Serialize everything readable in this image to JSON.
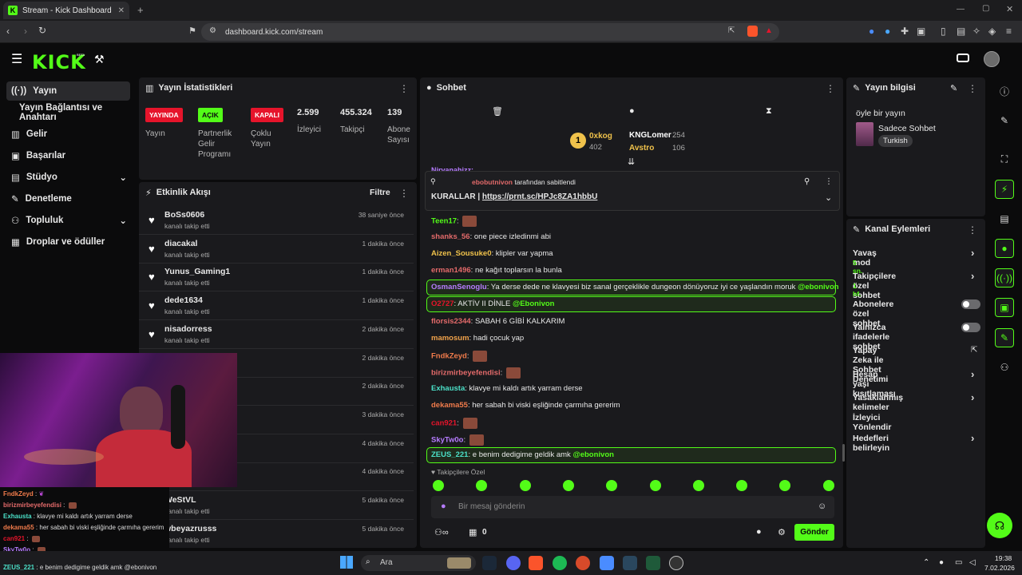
{
  "browser": {
    "tab_title": "Stream - Kick Dashboard",
    "url": "dashboard.kick.com/stream",
    "new_tab": "+"
  },
  "nav": {
    "logo": "KICK",
    "beta": "BETA"
  },
  "sidebar": {
    "items": [
      {
        "label": "Yayın",
        "icon": "broadcast-icon"
      },
      {
        "label": "Yayın Bağlantısı ve Anahtarı",
        "icon": ""
      },
      {
        "label": "Gelir",
        "icon": "chart-icon"
      },
      {
        "label": "Başarılar",
        "icon": "trophy-icon"
      },
      {
        "label": "Stüdyo",
        "icon": "studio-icon"
      },
      {
        "label": "Denetleme",
        "icon": "wrench-icon"
      },
      {
        "label": "Topluluk",
        "icon": "people-icon"
      },
      {
        "label": "Droplar ve ödüller",
        "icon": "gift-icon"
      }
    ]
  },
  "stats": {
    "title": "Yayın İstatistikleri",
    "badges": [
      {
        "text": "YAYINDA",
        "label": "Yayın",
        "color": "#e6142b"
      },
      {
        "text": "AÇIK",
        "label": "Partnerlik\nGelir\nProgramı",
        "color": "#53fc18"
      },
      {
        "text": "KAPALI",
        "label": "Çoklu\nYayın",
        "color": "#e6142b"
      }
    ],
    "numbers": [
      {
        "value": "2.599",
        "label": "İzleyici"
      },
      {
        "value": "455.324",
        "label": "Takipçi"
      },
      {
        "value": "139",
        "label": "Abone\nSayısı"
      }
    ]
  },
  "activity": {
    "title": "Etkinlik Akışı",
    "filter": "Filtre",
    "items": [
      {
        "name": "BoSs0606",
        "sub": "kanalı takip etti",
        "time": "38 saniye önce"
      },
      {
        "name": "diacakal",
        "sub": "kanalı takip etti",
        "time": "1 dakika önce"
      },
      {
        "name": "Yunus_Gaming1",
        "sub": "kanalı takip etti",
        "time": "1 dakika önce"
      },
      {
        "name": "dede1634",
        "sub": "kanalı takip etti",
        "time": "1 dakika önce"
      },
      {
        "name": "nisadorress",
        "sub": "kanalı takip etti",
        "time": "2 dakika önce"
      },
      {
        "name": "",
        "sub": "",
        "time": "2 dakika önce"
      },
      {
        "name": "",
        "sub": "",
        "time": "2 dakika önce"
      },
      {
        "name": "",
        "sub": "",
        "time": "3 dakika önce"
      },
      {
        "name": "",
        "sub": "",
        "time": "4 dakika önce"
      },
      {
        "name": "",
        "sub": "",
        "time": "4 dakika önce"
      },
      {
        "name": "WeStVL",
        "sub": "kanalı takip etti",
        "time": "5 dakika önce"
      },
      {
        "name": "wbeyazrusss",
        "sub": "kanalı takip etti",
        "time": "5 dakika önce"
      }
    ]
  },
  "chat": {
    "title": "Sohbet",
    "leaders": [
      {
        "rank": "1",
        "name": "0xkog",
        "count": "402"
      },
      {
        "name": "KNGLomer",
        "count": "254"
      },
      {
        "name": "Avstro",
        "count": "106"
      }
    ],
    "pinned": {
      "by": "ebobutnivon",
      "by_suffix": "tarafından sabitlendi",
      "text": "KURALLAR |",
      "link": "https://prnt.sc/HPJc8ZA1hbbU"
    },
    "partial_top": "Nirvanahizz:",
    "messages": [
      {
        "user": "Teen17",
        "color": "#53fc18",
        "text": ""
      },
      {
        "user": "shanks_56",
        "color": "#e36a6a",
        "text": "one piece izledinmi abi"
      },
      {
        "user": "Aizen_Sousuke0",
        "color": "#f0c24b",
        "text": "klipler var yapma"
      },
      {
        "user": "erman1496",
        "color": "#e36a6a",
        "text": "ne kağıt toplarsın la bunla"
      },
      {
        "user": "OsmanSenoglu",
        "color": "#b67cff",
        "text": "Ya derse dede ne klavyesi biz sanal gerçeklikle dungeon dönüyoruz iyi ce yaşlandın moruk",
        "mention": "@ebonivon"
      },
      {
        "user": "O2727",
        "color": "#e6142b",
        "text": "AKTİV II DİNLE",
        "mention": "@Ebonivon"
      },
      {
        "user": "florsis2344",
        "color": "#e36a6a",
        "text": "SABAH 6 GİBİ KALKARIM"
      },
      {
        "user": "mamosum",
        "color": "#f0a24b",
        "text": "hadi çocuk yap"
      },
      {
        "user": "FndkZeyd",
        "color": "#f07b4b",
        "text": ""
      },
      {
        "user": "birizmirbeyefendisi",
        "color": "#e36a6a",
        "text": ""
      },
      {
        "user": "Exhausta",
        "color": "#4be0c8",
        "text": "klavye mi kaldı artık yarram derse"
      },
      {
        "user": "dekama55",
        "color": "#f07b4b",
        "text": "her sabah bi viski eşliğinde çarmıha gererim"
      },
      {
        "user": "can921",
        "color": "#e6142b",
        "text": ""
      },
      {
        "user": "SkyTw0o",
        "color": "#b67cff",
        "text": ""
      },
      {
        "user": "ZEUS_221",
        "color": "#4be0c8",
        "text": "e benim dedigime geldik amk",
        "mention": "@ebonivon"
      }
    ],
    "followers_only": "Takipçilere Özel",
    "input_placeholder": "Bir mesaj gönderin",
    "points": "0",
    "send": "Gönder"
  },
  "info": {
    "title": "Yayın bilgisi",
    "stream_title": "öyle bir yayın",
    "category": "Sadece Sohbet",
    "tag": "Turkish"
  },
  "actions": {
    "title": "Kanal Eylemleri",
    "items": [
      {
        "label": "Yavaş mod",
        "sub": "5 sn.",
        "kind": "chevron"
      },
      {
        "label": "Takipçilere özel sohbet",
        "sub": "1 hf.",
        "kind": "chevron"
      },
      {
        "label": "Abonelere özel sohbet",
        "sub": "",
        "kind": "toggle"
      },
      {
        "label": "Yalnızca ifadelerle sohbet",
        "sub": "",
        "kind": "toggle"
      },
      {
        "label": "Yapay Zeka ile Sohbet Denetimi",
        "sub": "",
        "kind": "external"
      },
      {
        "label": "Hesap yaşı kısıtlaması",
        "sub": "",
        "kind": "chevron"
      },
      {
        "label": "Yasaklanmış kelimeler",
        "sub": "",
        "kind": "chevron"
      },
      {
        "label": "İzleyici Yönlendir",
        "sub": "",
        "kind": "none"
      },
      {
        "label": "Hedefleri belirleyin",
        "sub": "",
        "kind": "chevron"
      }
    ]
  },
  "overlay": {
    "lines": [
      {
        "user": "FndkZeyd",
        "text": ""
      },
      {
        "user": "birizmirbeyefendisi",
        "text": ""
      },
      {
        "user": "Exhausta",
        "text": "klavye mi kaldı artık yarram derse"
      },
      {
        "user": "dekama55",
        "text": "her sabah bi viski eşliğinde çarmıha gererim"
      },
      {
        "user": "can921",
        "text": ""
      },
      {
        "user": "SkyTw0o",
        "text": ""
      },
      {
        "user": "ZEUS_221",
        "text": "e benim dedigime geldik amk @ebonivon"
      }
    ]
  },
  "taskbar": {
    "search": "Ara",
    "time": "19:38",
    "date": "7.02.2026"
  },
  "colors": {
    "accent": "#53fc18",
    "red": "#e6142b"
  }
}
